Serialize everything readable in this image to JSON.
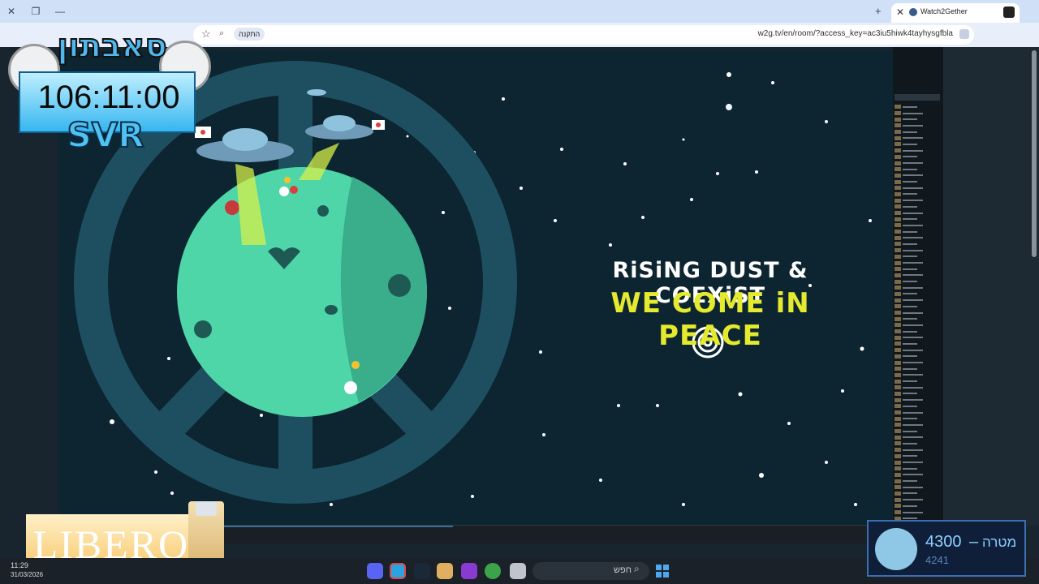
{
  "browser": {
    "tab_title": "Watch2Gether",
    "install_label": "התקנה",
    "url": "w2g.tv/en/room/?access_key=ac3iu5hiwk4tayhysgfbla"
  },
  "video": {
    "line1": "RiSiNG DUST & COEXiST",
    "line2": "WE COME iN PEACE"
  },
  "overlay": {
    "channel_logo": "סאבתון",
    "timer": "106:11:00",
    "tag": "SVR"
  },
  "sponsor": {
    "brand": "LIBERO"
  },
  "goal": {
    "current": "4300",
    "dash": "–",
    "label": "מטרה",
    "total": "4241"
  },
  "taskbar": {
    "time": "11:29",
    "date": "31/03/2026",
    "search_placeholder": "חפש"
  },
  "colors": {
    "accent_yellow": "#e5ea2e",
    "video_bg": "#0c2530",
    "planet": "#4fd6a8",
    "peace_ring": "#1e4f61"
  }
}
